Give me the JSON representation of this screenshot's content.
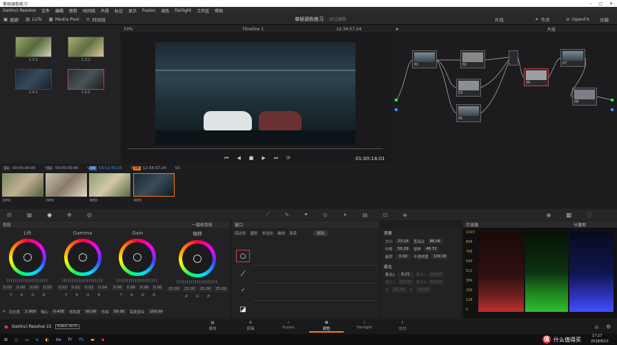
{
  "window": {
    "title": "单帧调色练习"
  },
  "menu": [
    "DaVinci Resolve",
    "文件",
    "编辑",
    "修剪",
    "时间线",
    "片段",
    "标记",
    "显示",
    "Fusion",
    "调色",
    "Fairlight",
    "工作区",
    "帮助"
  ],
  "toolbar": {
    "gallery": "画廊",
    "luts": "LUTs",
    "media_pool": "Media Pool",
    "timeline": "时间线",
    "project_name": "单帧调色练习",
    "edited": "经过编辑",
    "clip": "片段",
    "nodes": "节点",
    "openfx": "OpenFX",
    "lightbox": "光箱"
  },
  "gallery": {
    "stills": [
      "1.3.1",
      "1.3.2",
      "1.4.1",
      "1.4.2"
    ]
  },
  "viewer": {
    "zoom": "33%",
    "timeline_name": "Timeline 1",
    "timecode": "12:34:57:24",
    "duration": "01:00:14:01"
  },
  "nodes_panel": {
    "mode": "片段",
    "nodes": [
      "01",
      "02",
      "03",
      "04",
      "05",
      "06",
      "07",
      "08"
    ]
  },
  "clips": [
    {
      "num": "01",
      "tc": "00:00:00:00",
      "track": "V1",
      "codec": "DPX"
    },
    {
      "num": "02",
      "tc": "00:00:00:00",
      "track": "V1",
      "codec": "DPX"
    },
    {
      "num": "03",
      "tc": "13:12:43:15",
      "track": "V1",
      "codec": "RED"
    },
    {
      "num": "04",
      "tc": "12:34:57:24",
      "track": "V1",
      "codec": "RED"
    }
  ],
  "color_wheels": {
    "title": "色轮",
    "mode": "一级校色轮",
    "wheels": [
      {
        "name": "Lift",
        "vals": [
          "0.00",
          "0.00",
          "0.00",
          "0.00"
        ]
      },
      {
        "name": "Gamma",
        "vals": [
          "0.02",
          "0.01",
          "0.02",
          "0.04"
        ]
      },
      {
        "name": "Gain",
        "vals": [
          "0.96",
          "0.96",
          "0.96",
          "0.96"
        ]
      },
      {
        "name": "偏移",
        "vals": [
          "25.00",
          "25.00",
          "25.00",
          "25.00"
        ]
      }
    ],
    "channels": [
      "Y",
      "R",
      "G",
      "B"
    ],
    "bottom": {
      "contrast_label": "对比度",
      "contrast": "1.000",
      "pivot_label": "轴心",
      "pivot": "0.435",
      "sat_label": "饱和度",
      "sat": "50.00",
      "hue_label": "色相",
      "hue": "50.00",
      "lummix_label": "亮度混合",
      "lummix": "100.00"
    }
  },
  "window_panel": {
    "title": "窗口",
    "tools": [
      "四边形",
      "圆形",
      "多边形",
      "曲线",
      "渐变"
    ],
    "delete": "删除"
  },
  "transform": {
    "title": "变换",
    "size_label": "大小",
    "size": "23.16",
    "aspect_label": "宽高比",
    "aspect": "86.06",
    "pan_label": "中移",
    "pan": "50.29",
    "tilt_label": "竖移",
    "tilt": "48.72",
    "rotate_label": "旋转",
    "rotate": "0.00",
    "opacity_label": "不透明度",
    "opacity": "100.00",
    "soft_title": "柔化",
    "soft1_label": "柔化1",
    "soft1": "8.21",
    "soft2_label": "柔化2",
    "soft2": "50.00",
    "soft3_label": "柔化3",
    "soft3": "50.00",
    "soft4_label": "柔化4",
    "soft4": "50.00",
    "inside_label": "内",
    "inside": "50.00",
    "outside_label": "外",
    "outside": "50.00"
  },
  "scopes": {
    "title": "示波器",
    "mode": "分量图",
    "ticks": [
      "1023",
      "896",
      "768",
      "640",
      "512",
      "384",
      "256",
      "128",
      "0"
    ]
  },
  "pages": {
    "media": "媒体",
    "edit": "剪辑",
    "fusion": "Fusion",
    "color": "调色",
    "fairlight": "Fairlight",
    "deliver": "交付"
  },
  "brand": {
    "name": "DaVinci Resolve 15",
    "badge": "PUBLIC BETA"
  },
  "taskbar": {
    "time": "17:27",
    "date": "2018/9/13",
    "watermark": "什么值得买"
  },
  "colors": {
    "accent": "#ff7a1a",
    "selected": "#d04040",
    "clip_num_active": "#1e6dbd"
  }
}
